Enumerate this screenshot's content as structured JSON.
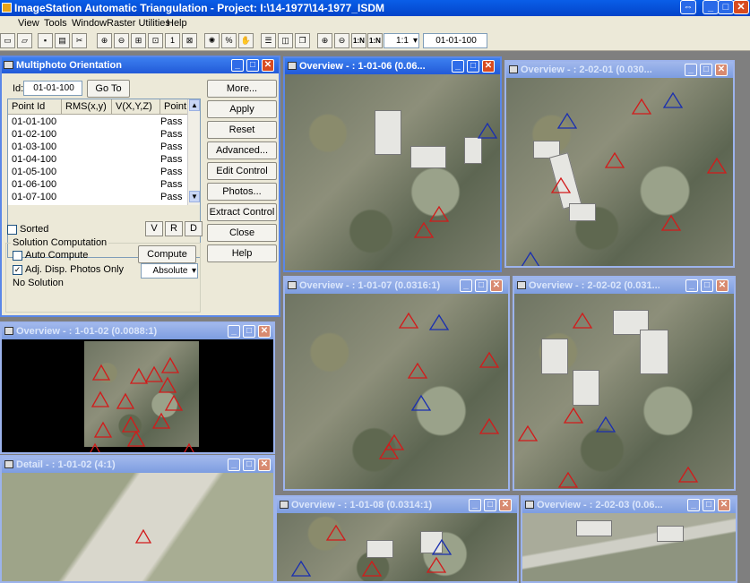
{
  "app": {
    "title": "ImageStation Automatic Triangulation - Project: I:\\14-1977\\14-1977_ISDM"
  },
  "menu": [
    "View",
    "Tools",
    "Window",
    "Raster Utilities",
    "Help"
  ],
  "toolbar": {
    "zoom_select": "1:1",
    "point_field": "01-01-100",
    "btn_1n": "1:N",
    "btn_1n_b": "1:N"
  },
  "dialog": {
    "title": "Multiphoto Orientation",
    "id_label": "Id:",
    "id_value": "01-01-100",
    "goto_label": "Go To",
    "columns": [
      "Point Id",
      "RMS(x,y)",
      "V(X,Y,Z)",
      "Point T"
    ],
    "rows": [
      {
        "id": "01-01-100",
        "status": "Pass"
      },
      {
        "id": "01-02-100",
        "status": "Pass"
      },
      {
        "id": "01-03-100",
        "status": "Pass"
      },
      {
        "id": "01-04-100",
        "status": "Pass"
      },
      {
        "id": "01-05-100",
        "status": "Pass"
      },
      {
        "id": "01-06-100",
        "status": "Pass"
      },
      {
        "id": "01-07-100",
        "status": "Pass"
      }
    ],
    "sorted_label": "Sorted",
    "v_label": "V",
    "r_label": "R",
    "d_label": "D",
    "solution_label": "Solution Computation",
    "auto_compute_label": "Auto Compute",
    "adj_disp_label": "Adj. Disp. Photos Only",
    "no_solution_label": "No Solution",
    "compute_label": "Compute",
    "absolute_value": "Absolute",
    "buttons": [
      "More...",
      "Apply",
      "Reset",
      "Advanced...",
      "Edit Control",
      "Photos...",
      "Extract Control",
      "Close",
      "Help"
    ]
  },
  "windows": {
    "ov_10102": "Overview - : 1-01-02  (0.0088:1)",
    "detail": "Detail - : 1-01-02  (4:1)",
    "ov_10106": "Overview - : 1-01-06  (0.06...",
    "ov_20201": "Overview - : 2-02-01  (0.030...",
    "ov_10107": "Overview - : 1-01-07  (0.0316:1)",
    "ov_20202": "Overview - : 2-02-02  (0.031...",
    "ov_10108": "Overview - : 1-01-08  (0.0314:1)",
    "ov_20203": "Overview - : 2-02-03  (0.06..."
  },
  "colors": {
    "marker_red": "#d21b1b",
    "marker_blue": "#1a2fb0",
    "marker_green": "#2fc82f",
    "title_active": "#225ad8"
  }
}
